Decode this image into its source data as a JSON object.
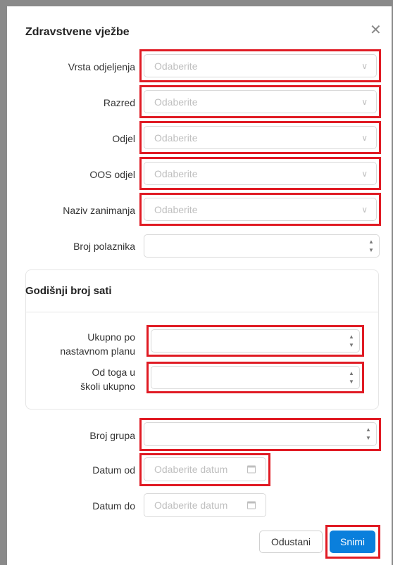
{
  "dialog": {
    "title": "Zdravstvene vježbe",
    "close_symbol": "✕"
  },
  "fields": {
    "vrsta_odjeljenja": {
      "label": "Vrsta odjeljenja",
      "placeholder": "Odaberite"
    },
    "razred": {
      "label": "Razred",
      "placeholder": "Odaberite"
    },
    "odjel": {
      "label": "Odjel",
      "placeholder": "Odaberite"
    },
    "oos_odjel": {
      "label": "OOS odjel",
      "placeholder": "Odaberite"
    },
    "naziv_zanimanja": {
      "label": "Naziv zanimanja",
      "placeholder": "Odaberite"
    },
    "broj_polaznika": {
      "label": "Broj polaznika",
      "value": ""
    }
  },
  "hours_section": {
    "title": "Godišnji broj sati",
    "ukupno": {
      "label_line1": "Ukupno po",
      "label_line2": "nastavnom planu",
      "value": ""
    },
    "od_toga": {
      "label_line1": "Od toga u",
      "label_line2": "školi ukupno",
      "value": ""
    }
  },
  "broj_grupa": {
    "label": "Broj grupa",
    "value": ""
  },
  "datum_od": {
    "label": "Datum od",
    "placeholder": "Odaberite datum"
  },
  "datum_do": {
    "label": "Datum do",
    "placeholder": "Odaberite datum"
  },
  "buttons": {
    "cancel": "Odustani",
    "save": "Snimi"
  },
  "icons": {
    "chevron": "chevron-down-icon",
    "spinner": "number-stepper-icon",
    "calendar": "calendar-icon",
    "close": "close-icon"
  },
  "colors": {
    "highlight": "#e01b24",
    "primary": "#0a7fdc",
    "placeholder": "#bfbfbf"
  }
}
